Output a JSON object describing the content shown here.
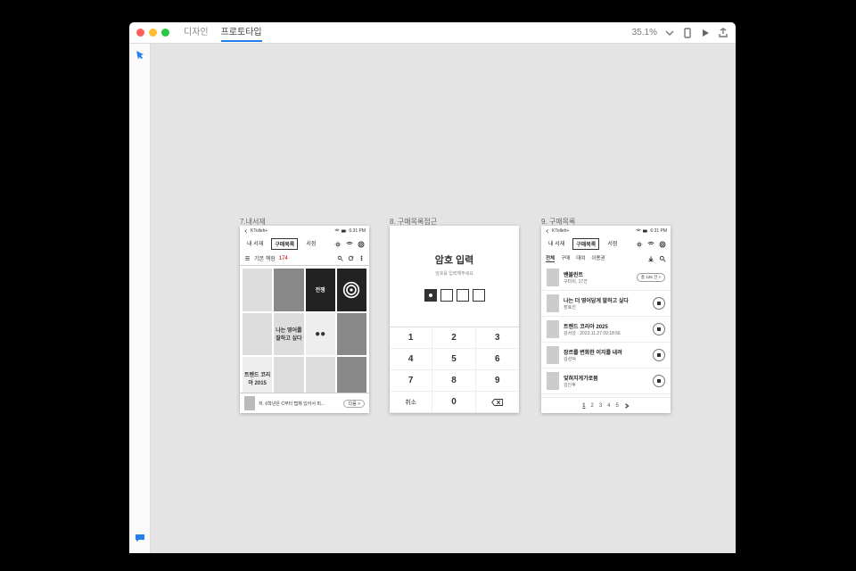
{
  "titlebar": {
    "tabs": {
      "design": "디자인",
      "prototype": "프로토타입"
    },
    "zoom": "35.1%"
  },
  "artboards": {
    "a1": {
      "label": "7.내서재"
    },
    "a2": {
      "label": "8. 구매목록접근"
    },
    "a3": {
      "label": "9. 구매목록"
    }
  },
  "status": {
    "carrier": "KTolleh+",
    "time": "6:31 PM"
  },
  "screen1": {
    "nav": {
      "t1": "내 서재",
      "t2": "구매목록",
      "t3": "서점"
    },
    "subbar": {
      "label": "기본 책장",
      "count": "174"
    },
    "books": [
      "",
      "",
      "전쟁",
      "",
      "",
      "나는 영어를 잘하고 싶다",
      "",
      "",
      "트렌드 코리아 2015",
      "",
      "",
      ""
    ],
    "bottom": {
      "text": "저. 6학년은 C부터 탭체 있어서 피...",
      "go": "다음 >"
    }
  },
  "screen2": {
    "title": "암호 입력",
    "subtitle": "암호를 입력해주세요",
    "keys": [
      "1",
      "2",
      "3",
      "4",
      "5",
      "6",
      "7",
      "8",
      "9"
    ],
    "cancel": "취소",
    "zero": "0"
  },
  "screen3": {
    "nav": {
      "t1": "내 서재",
      "t2": "구매목록",
      "t3": "서점"
    },
    "filters": {
      "f1": "전체",
      "f2": "구매",
      "f3": "대여",
      "f4": "이용권"
    },
    "items": [
      {
        "title": "밴블린트",
        "meta": "구미쉬, 17건",
        "pill": "총 125 건 >"
      },
      {
        "title": "나는 더 영어답게 말하고 싶다",
        "meta": "장효선"
      },
      {
        "title": "트렌드 코리아 2025",
        "meta": "강서성 · 2023.11.27 09:18:56"
      },
      {
        "title": "장르를 변화한 이지를 내려",
        "meta": "김성덕"
      },
      {
        "title": "잊혀지게가로봄",
        "meta": "김인후"
      }
    ],
    "pages": [
      "1",
      "2",
      "3",
      "4",
      "5"
    ]
  }
}
